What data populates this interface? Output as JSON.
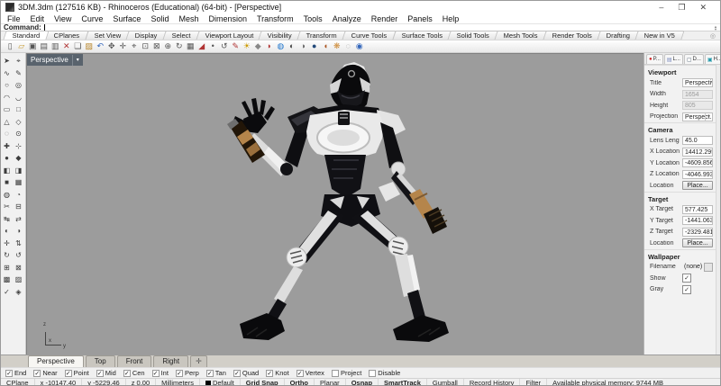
{
  "window": {
    "title": "3DM.3dm (127516 KB) - Rhinoceros (Educational) (64-bit) - [Perspective]",
    "controls": {
      "minimize": "–",
      "maximize": "❐",
      "close": "✕"
    }
  },
  "menu": {
    "items": [
      {
        "label": "File"
      },
      {
        "label": "Edit"
      },
      {
        "label": "View"
      },
      {
        "label": "Curve"
      },
      {
        "label": "Surface"
      },
      {
        "label": "Solid"
      },
      {
        "label": "Mesh"
      },
      {
        "label": "Dimension"
      },
      {
        "label": "Transform"
      },
      {
        "label": "Tools"
      },
      {
        "label": "Analyze"
      },
      {
        "label": "Render"
      },
      {
        "label": "Panels"
      },
      {
        "label": "Help"
      }
    ]
  },
  "command": {
    "label": "Command:",
    "value": "",
    "spinner_up": "▲",
    "spinner_down": "▼"
  },
  "toolbar_tabs": {
    "gear_glyph": "◎",
    "items": [
      {
        "label": "Standard",
        "cls": "active"
      },
      {
        "label": "CPlanes"
      },
      {
        "label": "Set View"
      },
      {
        "label": "Display"
      },
      {
        "label": "Select"
      },
      {
        "label": "Viewport Layout"
      },
      {
        "label": "Visibility"
      },
      {
        "label": "Transform"
      },
      {
        "label": "Curve Tools"
      },
      {
        "label": "Surface Tools"
      },
      {
        "label": "Solid Tools"
      },
      {
        "label": "Mesh Tools"
      },
      {
        "label": "Render Tools"
      },
      {
        "label": "Drafting"
      },
      {
        "label": "New in V5"
      }
    ]
  },
  "toolbar_icons": {
    "items": [
      {
        "name": "new-file-icon",
        "glyph": "▯",
        "color": "#555555"
      },
      {
        "name": "open-folder-icon",
        "glyph": "▱",
        "color": "#c79b2e"
      },
      {
        "name": "save-icon",
        "glyph": "▣",
        "color": "#555555"
      },
      {
        "name": "print-icon",
        "glyph": "▤",
        "color": "#555555"
      },
      {
        "name": "copy-clipboard-icon",
        "glyph": "▥",
        "color": "#555555"
      },
      {
        "name": "delete-icon",
        "glyph": "✕",
        "color": "#b03333"
      },
      {
        "name": "copy-icon",
        "glyph": "❏",
        "color": "#555555"
      },
      {
        "name": "paste-icon",
        "glyph": "▨",
        "color": "#b8862b"
      },
      {
        "name": "undo-icon",
        "glyph": "↶",
        "color": "#3366bb"
      },
      {
        "name": "pan-hand-icon",
        "glyph": "✥",
        "color": "#555555"
      },
      {
        "name": "move-icon",
        "glyph": "✛",
        "color": "#555555"
      },
      {
        "name": "zoom-dynamic-icon",
        "glyph": "⌖",
        "color": "#555555"
      },
      {
        "name": "zoom-window-icon",
        "glyph": "⊡",
        "color": "#555555"
      },
      {
        "name": "zoom-extents-icon",
        "glyph": "⊠",
        "color": "#555555"
      },
      {
        "name": "zoom-selected-icon",
        "glyph": "⊕",
        "color": "#555555"
      },
      {
        "name": "rotate-view-icon",
        "glyph": "↻",
        "color": "#555555"
      },
      {
        "name": "viewport-layout-icon",
        "glyph": "▦",
        "color": "#555555"
      },
      {
        "name": "cplane-icon",
        "glyph": "◢",
        "color": "#b03333"
      },
      {
        "name": "osnap-point-icon",
        "glyph": "•",
        "color": "#555555"
      },
      {
        "name": "history-icon",
        "glyph": "↺",
        "color": "#555555"
      },
      {
        "name": "annotate-icon",
        "glyph": "✎",
        "color": "#b03333"
      },
      {
        "name": "lightbulb-icon",
        "glyph": "☀",
        "color": "#cc9900"
      },
      {
        "name": "lock-icon",
        "glyph": "◆",
        "color": "#888888"
      },
      {
        "name": "layer-state-icon",
        "glyph": "◗",
        "color": "#b03333"
      },
      {
        "name": "render-icon",
        "glyph": "◍",
        "color": "#2277cc"
      },
      {
        "name": "shaded-mode-icon",
        "glyph": "◐",
        "color": "#444444"
      },
      {
        "name": "ghosted-mode-icon",
        "glyph": "◑",
        "color": "#666666"
      },
      {
        "name": "rendered-mode-icon",
        "glyph": "●",
        "color": "#234a7a"
      },
      {
        "name": "material-icon",
        "glyph": "◖",
        "color": "#aa5522"
      },
      {
        "name": "texture-icon",
        "glyph": "❋",
        "color": "#cc8833"
      },
      {
        "name": "environment-icon",
        "glyph": "◌",
        "color": "#888888"
      },
      {
        "name": "help-icon",
        "glyph": "◉",
        "color": "#3366bb"
      }
    ]
  },
  "sidebar_icons": {
    "items": [
      "➤",
      "⌖",
      "∿",
      "✎",
      "○",
      "◎",
      "◠",
      "◡",
      "▭",
      "□",
      "△",
      "◇",
      "◌",
      "⊙",
      "✚",
      "⊹",
      "●",
      "◆",
      "◧",
      "◨",
      "■",
      "▦",
      "◍",
      "◔",
      "✂",
      "⊟",
      "↹",
      "⇄",
      "◐",
      "◑",
      "✛",
      "⇅",
      "↻",
      "↺",
      "⊞",
      "⊠",
      "▩",
      "▨",
      "✓",
      "◈"
    ]
  },
  "viewport": {
    "label": "Perspective",
    "dropdown_glyph": "▾",
    "axis": {
      "x": "x",
      "y": "y",
      "z": "z"
    }
  },
  "panel": {
    "tabs": {
      "gear_glyph": "⚙",
      "items": [
        {
          "name": "properties-tab",
          "glyph": "●",
          "color": "#cc2222",
          "label": "P..."
        },
        {
          "name": "layers-tab",
          "glyph": "▤",
          "color": "#7788bb",
          "label": "L..."
        },
        {
          "name": "display-tab",
          "glyph": "▢",
          "color": "#556677",
          "label": "D..."
        },
        {
          "name": "help-tab",
          "glyph": "▣",
          "color": "#2299aa",
          "label": "H..."
        }
      ]
    },
    "viewport_section": {
      "header": "Viewport",
      "rows": [
        {
          "label": "Title",
          "value": "Perspective",
          "kind": "input"
        },
        {
          "label": "Width",
          "value": "1654",
          "kind": "disabled"
        },
        {
          "label": "Height",
          "value": "805",
          "kind": "disabled"
        },
        {
          "label": "Projection",
          "value": "Perspect...",
          "kind": "select"
        }
      ]
    },
    "camera": {
      "header": "Camera",
      "rows": [
        {
          "label": "Lens Length",
          "value": "45.0",
          "kind": "input"
        },
        {
          "label": "X Location",
          "value": "14412.295",
          "kind": "input"
        },
        {
          "label": "Y Location",
          "value": "-4609.856",
          "kind": "input"
        },
        {
          "label": "Z Location",
          "value": "-4046.993",
          "kind": "input"
        },
        {
          "label": "Location",
          "value": "Place...",
          "kind": "button"
        }
      ]
    },
    "target": {
      "header": "Target",
      "rows": [
        {
          "label": "X Target",
          "value": "577.425",
          "kind": "input"
        },
        {
          "label": "Y Target",
          "value": "-1441.063",
          "kind": "input"
        },
        {
          "label": "Z Target",
          "value": "-2329.481",
          "kind": "input"
        },
        {
          "label": "Location",
          "value": "Place...",
          "kind": "button"
        }
      ]
    },
    "wallpaper": {
      "header": "Wallpaper",
      "rows": [
        {
          "label": "Filename",
          "value": "(none)",
          "kind": "file"
        },
        {
          "label": "Show",
          "value": "✓",
          "kind": "check"
        },
        {
          "label": "Gray",
          "value": "✓",
          "kind": "check"
        }
      ]
    }
  },
  "viewport_tabs": {
    "items": [
      {
        "label": "Perspective",
        "cls": "active"
      },
      {
        "label": "Top"
      },
      {
        "label": "Front"
      },
      {
        "label": "Right"
      },
      {
        "label": "✛",
        "cls": "plus"
      }
    ]
  },
  "osnap": {
    "check_glyph": "✓",
    "items": [
      {
        "label": "End",
        "cls": "checked"
      },
      {
        "label": "Near",
        "cls": "checked"
      },
      {
        "label": "Point",
        "cls": "checked"
      },
      {
        "label": "Mid",
        "cls": "checked"
      },
      {
        "label": "Cen",
        "cls": "checked"
      },
      {
        "label": "Int",
        "cls": "checked"
      },
      {
        "label": "Perp",
        "cls": "checked"
      },
      {
        "label": "Tan",
        "cls": "checked"
      },
      {
        "label": "Quad",
        "cls": "checked"
      },
      {
        "label": "Knot",
        "cls": "checked"
      },
      {
        "label": "Vertex",
        "cls": "checked"
      },
      {
        "label": "Project",
        "cls": ""
      },
      {
        "label": "Disable",
        "cls": ""
      }
    ]
  },
  "status_bar": {
    "items": [
      {
        "label": "CPlane"
      },
      {
        "label": "x -10147.40"
      },
      {
        "label": "y -5229.46"
      },
      {
        "label": "z 0.00"
      },
      {
        "label": "Millimeters"
      },
      {
        "label": "Default",
        "cls": "swatch"
      },
      {
        "label": "Grid Snap",
        "cls": "bold"
      },
      {
        "label": "Ortho",
        "cls": "bold"
      },
      {
        "label": "Planar"
      },
      {
        "label": "Osnap",
        "cls": "bold"
      },
      {
        "label": "SmartTrack",
        "cls": "bold"
      },
      {
        "label": "Gumball"
      },
      {
        "label": "Record History"
      },
      {
        "label": "Filter"
      },
      {
        "label": "Available physical memory: 9744 MB",
        "cls": "mem"
      }
    ]
  },
  "colors": {
    "viewport_bg": "#9c9c9c",
    "viewport_label_bg": "#59636d",
    "armor_white": "#e9e9e9",
    "armor_black": "#0d0d10",
    "weapon_tan": "#b5854b"
  }
}
